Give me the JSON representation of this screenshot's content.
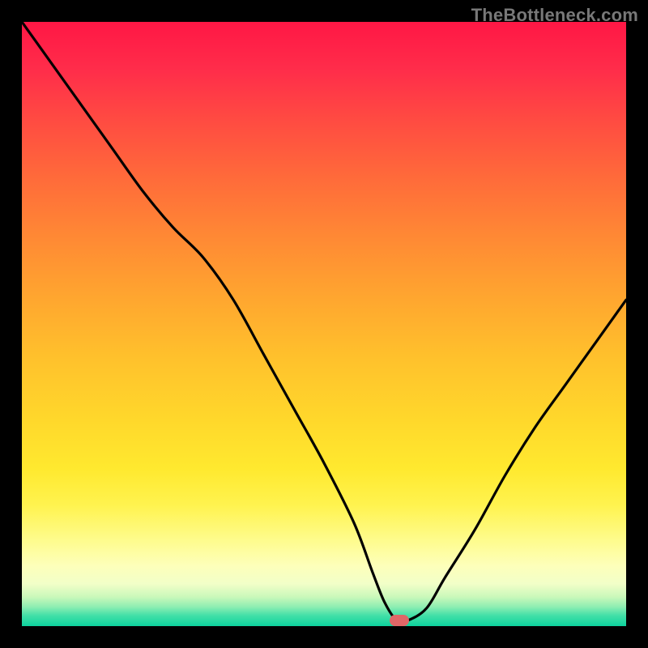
{
  "watermark": "TheBottleneck.com",
  "marker": {
    "x_pct": 62.5,
    "y_pct": 99.0
  },
  "chart_data": {
    "type": "line",
    "title": "",
    "xlabel": "",
    "ylabel": "",
    "xlim": [
      0,
      100
    ],
    "ylim": [
      0,
      100
    ],
    "series": [
      {
        "name": "bottleneck-curve",
        "x": [
          0,
          5,
          10,
          15,
          20,
          25,
          30,
          35,
          40,
          45,
          50,
          55,
          58,
          60,
          62,
          64,
          67,
          70,
          75,
          80,
          85,
          90,
          95,
          100
        ],
        "values": [
          100,
          93,
          86,
          79,
          72,
          66,
          61,
          54,
          45,
          36,
          27,
          17,
          9,
          4,
          1,
          1,
          3,
          8,
          16,
          25,
          33,
          40,
          47,
          54
        ]
      }
    ],
    "annotations": [
      {
        "type": "marker",
        "x": 62.5,
        "y": 1.0,
        "label": "optimal-point"
      }
    ],
    "background_gradient": {
      "direction": "top-to-bottom",
      "stops": [
        {
          "pos": 0.0,
          "color": "#ff1745"
        },
        {
          "pos": 0.26,
          "color": "#ff6b3a"
        },
        {
          "pos": 0.56,
          "color": "#ffc22c"
        },
        {
          "pos": 0.8,
          "color": "#fff34f"
        },
        {
          "pos": 0.93,
          "color": "#f2ffc8"
        },
        {
          "pos": 1.0,
          "color": "#0dd29d"
        }
      ]
    }
  }
}
